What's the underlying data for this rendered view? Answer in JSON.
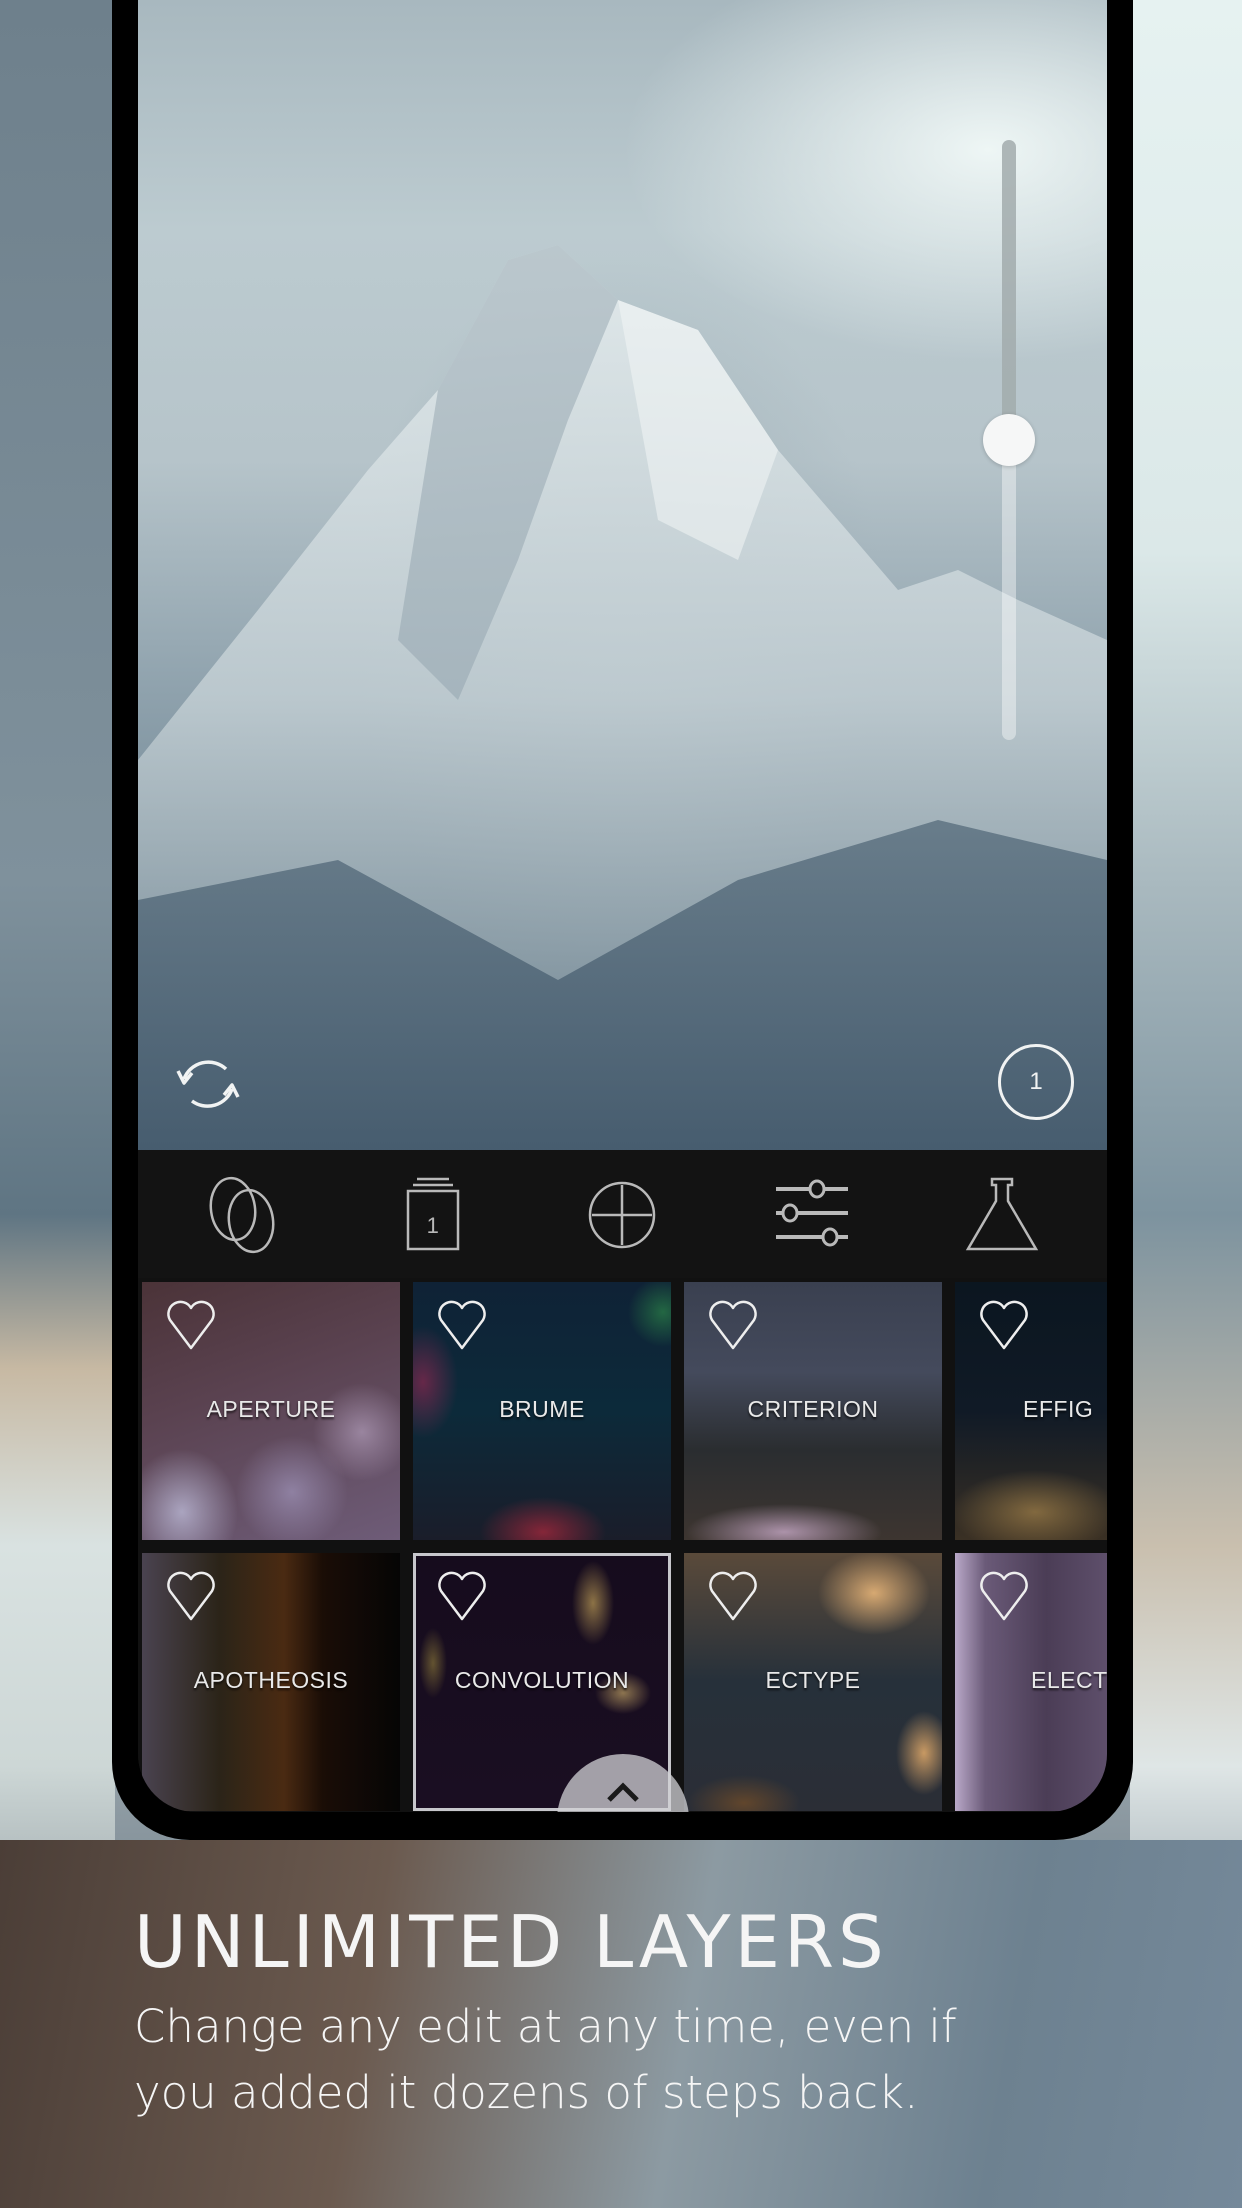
{
  "canvas": {
    "slider": {
      "label": "layer-opacity",
      "value": 0.5
    },
    "reset_button": {
      "icon": "reset-rotate-icon"
    },
    "layer_count_button": {
      "value": "1"
    }
  },
  "toolbar": {
    "items": [
      {
        "name": "blend",
        "icon": "blend-circles-icon"
      },
      {
        "name": "layers",
        "icon": "layer-stack-icon",
        "count": "1"
      },
      {
        "name": "add",
        "icon": "add-circle-icon"
      },
      {
        "name": "adjust",
        "icon": "sliders-icon"
      },
      {
        "name": "lab",
        "icon": "flask-icon"
      }
    ]
  },
  "filters": {
    "row1": [
      {
        "label": "APERTURE",
        "favorite": false
      },
      {
        "label": "BRUME",
        "favorite": false
      },
      {
        "label": "CRITERION",
        "favorite": false
      },
      {
        "label": "EFFIG",
        "favorite": false
      }
    ],
    "row2": [
      {
        "label": "APOTHEOSIS",
        "favorite": false
      },
      {
        "label": "CONVOLUTION",
        "favorite": false,
        "selected": true
      },
      {
        "label": "ECTYPE",
        "favorite": false
      },
      {
        "label": "ELECT",
        "favorite": false
      }
    ]
  },
  "drawer_handle": {
    "icon": "chevron-up-icon"
  },
  "caption": {
    "title": "UNLIMITED LAYERS",
    "body": "Change any edit at any time, even if you added it dozens of steps back."
  },
  "colors": {
    "toolbar_bg": "#131313",
    "icon_stroke": "#b9b9b9",
    "caption_text": "#f5f5f5"
  }
}
